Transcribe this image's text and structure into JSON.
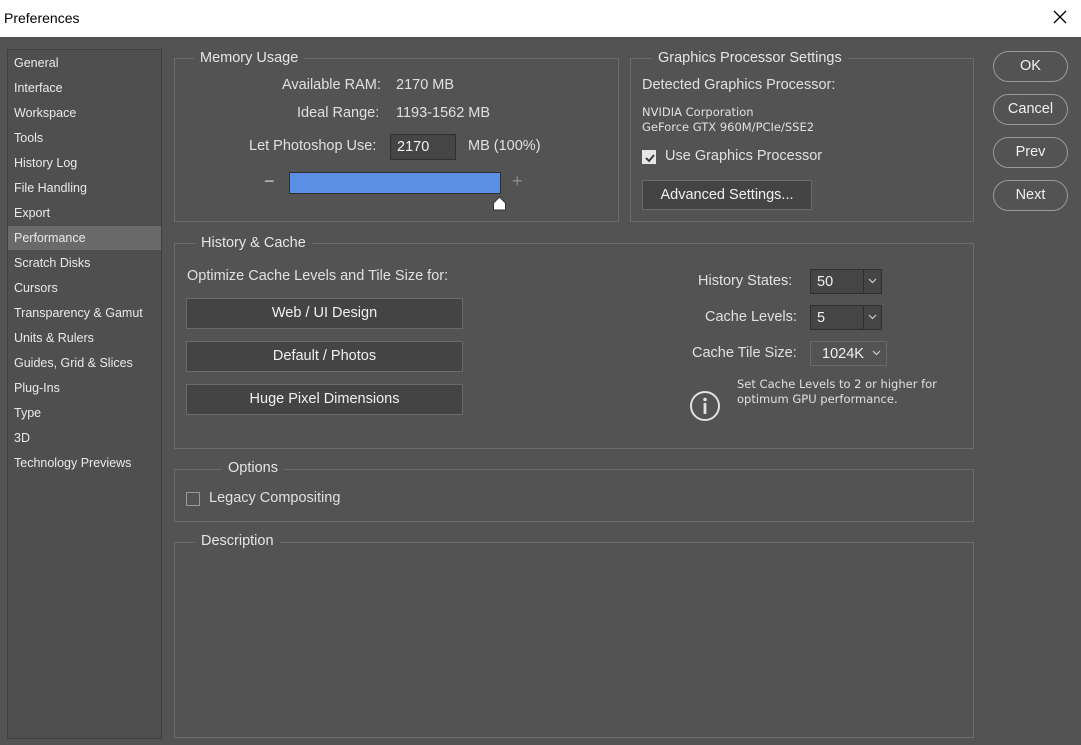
{
  "window": {
    "title": "Preferences"
  },
  "sidebar": {
    "items": [
      {
        "label": "General"
      },
      {
        "label": "Interface"
      },
      {
        "label": "Workspace"
      },
      {
        "label": "Tools"
      },
      {
        "label": "History Log"
      },
      {
        "label": "File Handling"
      },
      {
        "label": "Export"
      },
      {
        "label": "Performance",
        "active": true
      },
      {
        "label": "Scratch Disks"
      },
      {
        "label": "Cursors"
      },
      {
        "label": "Transparency & Gamut"
      },
      {
        "label": "Units & Rulers"
      },
      {
        "label": "Guides, Grid & Slices"
      },
      {
        "label": "Plug-Ins"
      },
      {
        "label": "Type"
      },
      {
        "label": "3D"
      },
      {
        "label": "Technology Previews"
      }
    ]
  },
  "memory": {
    "title": "Memory Usage",
    "available_label": "Available RAM:",
    "available_value": "2170 MB",
    "ideal_label": "Ideal Range:",
    "ideal_value": "1193-1562 MB",
    "use_label": "Let Photoshop Use:",
    "use_value": "2170",
    "use_suffix": "MB (100%)",
    "slider_fraction": 1.0,
    "minus": "−",
    "plus": "+"
  },
  "gpu": {
    "title": "Graphics Processor Settings",
    "detected_label": "Detected Graphics Processor:",
    "vendor": "NVIDIA Corporation",
    "model": "GeForce GTX 960M/PCIe/SSE2",
    "use_gpu_label": "Use Graphics Processor",
    "use_gpu_checked": true,
    "advanced_button": "Advanced Settings..."
  },
  "history_cache": {
    "title": "History & Cache",
    "optimize_label": "Optimize Cache Levels and Tile Size for:",
    "buttons": [
      "Web / UI Design",
      "Default / Photos",
      "Huge Pixel Dimensions"
    ],
    "history_states_label": "History States:",
    "history_states_value": "50",
    "cache_levels_label": "Cache Levels:",
    "cache_levels_value": "5",
    "tile_size_label": "Cache Tile Size:",
    "tile_size_value": "1024K",
    "info_line1": "Set Cache Levels to 2 or higher for",
    "info_line2": "optimum GPU performance."
  },
  "options": {
    "title": "Options",
    "legacy_label": "Legacy Compositing",
    "legacy_checked": false
  },
  "description": {
    "title": "Description"
  },
  "dialog_buttons": {
    "ok": "OK",
    "cancel": "Cancel",
    "prev": "Prev",
    "next": "Next"
  },
  "colors": {
    "background": "#535353",
    "accent": "#5b8fe3",
    "active_item": "#6a6a6a"
  }
}
